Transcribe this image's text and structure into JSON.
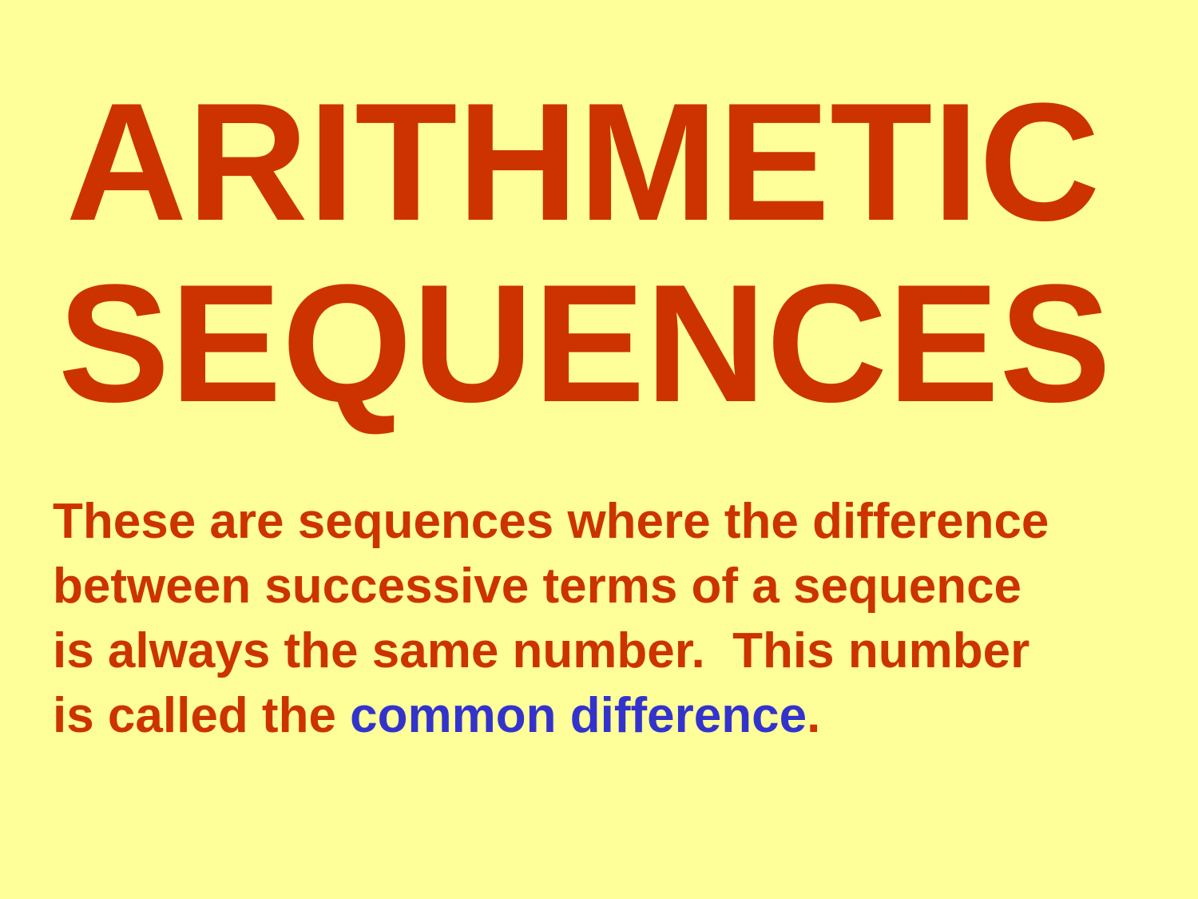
{
  "slide": {
    "title_line1": "ARITHMETIC",
    "title_line2": "SEQUENCES",
    "body_lines": [
      "These are sequences where the difference",
      "between successive terms of a sequence",
      "is always the same number.  This number"
    ],
    "last_line_prefix": "is called the ",
    "last_line_highlight": "common difference",
    "last_line_suffix": ".",
    "colors": {
      "background": "#ffff99",
      "primary_text": "#cc3300",
      "highlight_text": "#3333cc"
    }
  }
}
